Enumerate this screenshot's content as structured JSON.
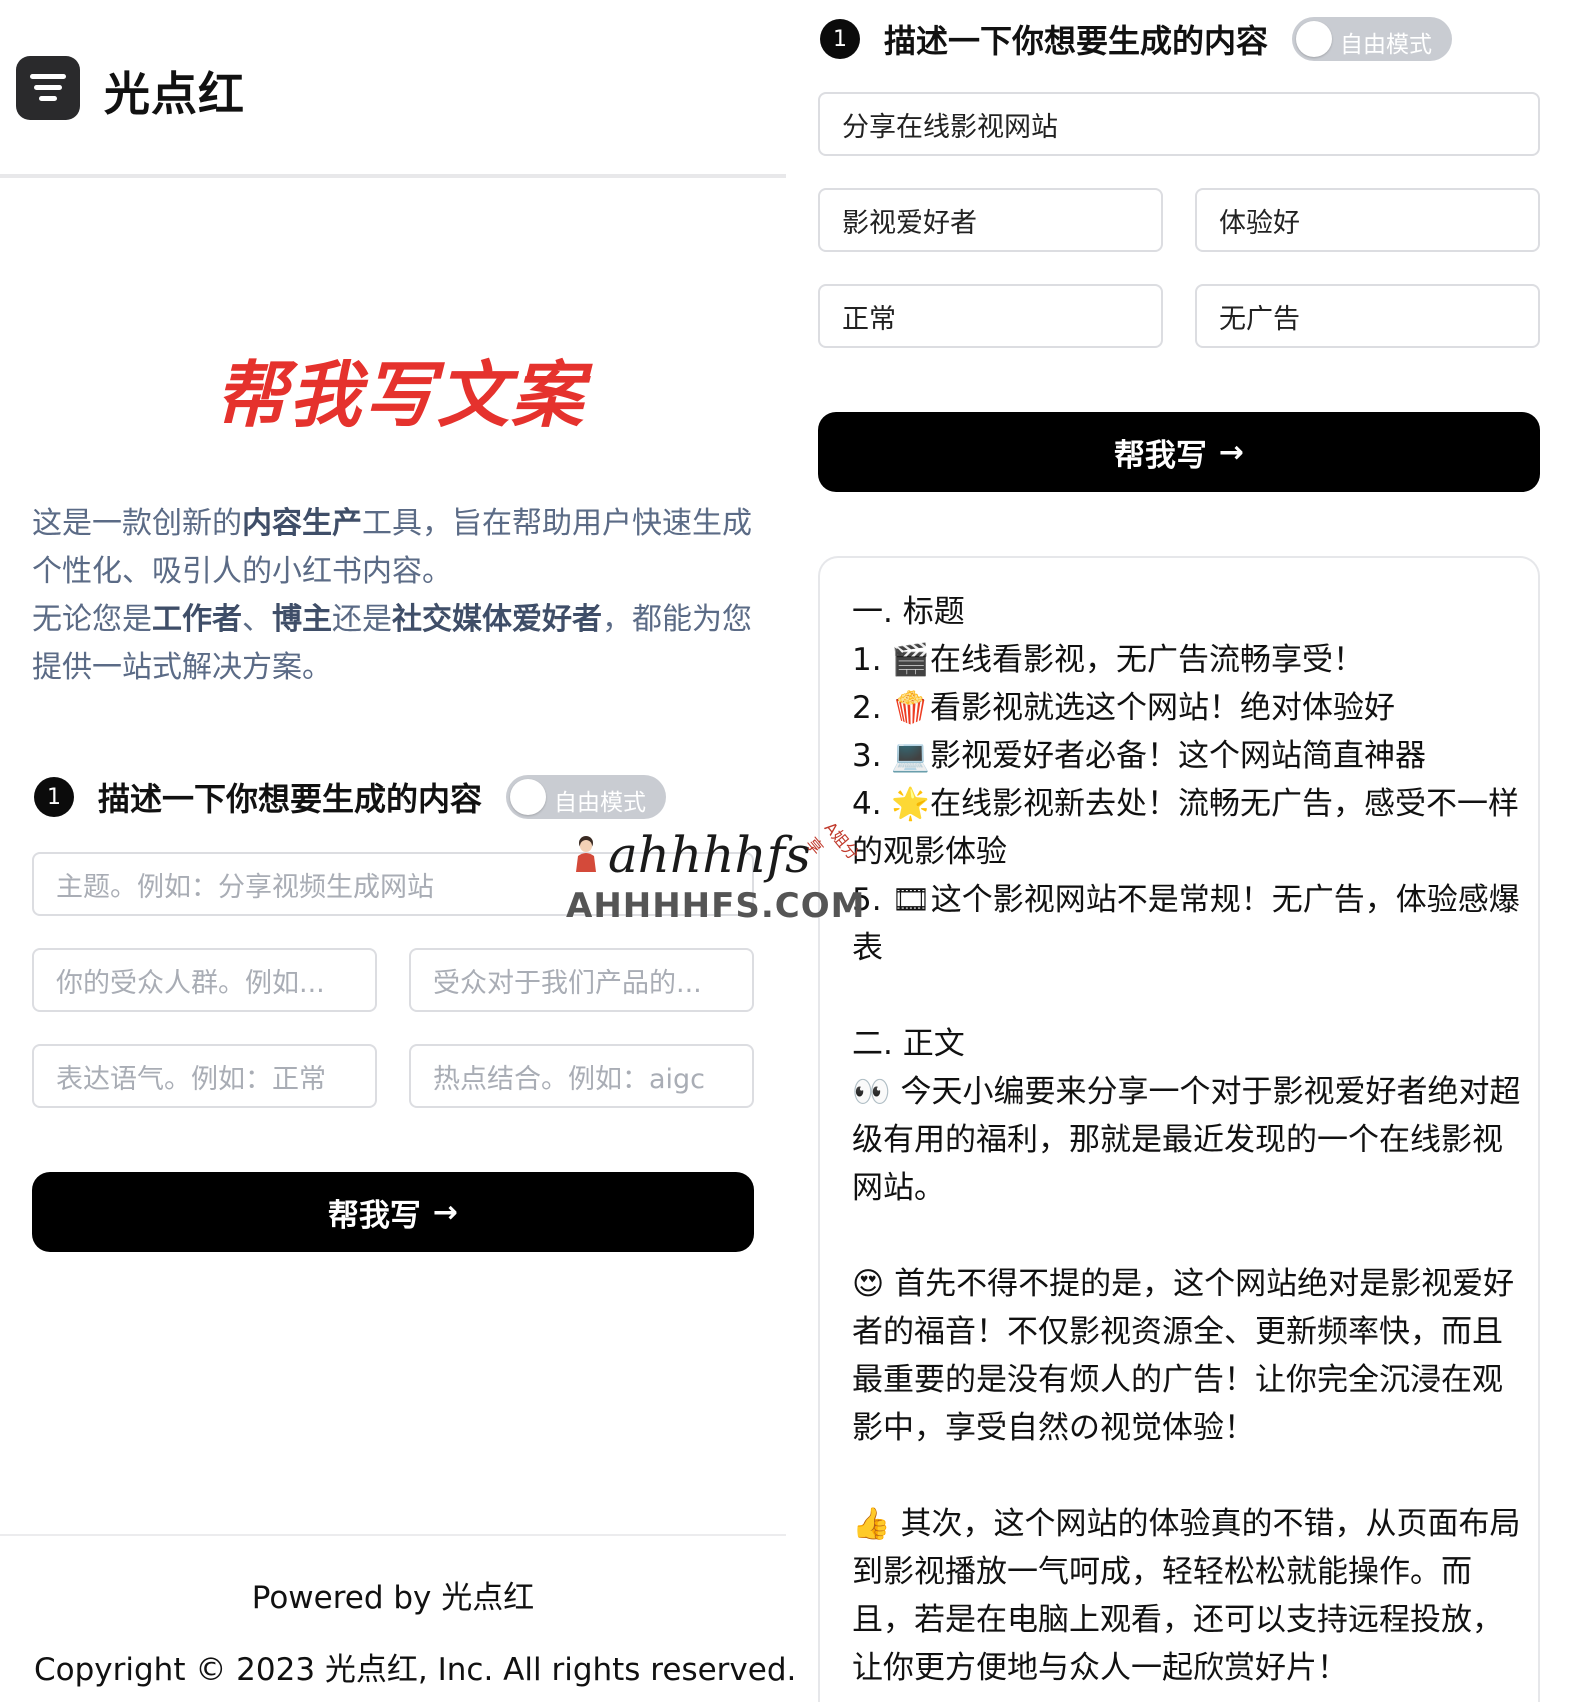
{
  "app": {
    "name": "光点红"
  },
  "hero": {
    "title": "帮我写文案"
  },
  "intro": {
    "line1_a": "这是一款创新的",
    "line1_b": "内容生产",
    "line1_c": "工具，旨在帮助用户快速生成个性化、吸引人的小红书内容。",
    "line2_a": "无论您是",
    "line2_b": "工作者",
    "line2_c": "、",
    "line2_d": "博主",
    "line2_e": "还是",
    "line2_f": "社交媒体爱好者",
    "line2_g": "，都能为您提供一站式解决方案。"
  },
  "form_empty": {
    "step_number": "1",
    "step_title": "描述一下你想要生成的内容",
    "mode_toggle": "自由模式",
    "topic_placeholder": "主题。例如：分享视频生成网站",
    "audience_placeholder": "你的受众人群。例如...",
    "value_placeholder": "受众对于我们产品的...",
    "tone_placeholder": "表达语气。例如：正常",
    "trend_placeholder": "热点结合。例如：aigc",
    "submit_label": "帮我写",
    "submit_arrow": "→"
  },
  "form_filled": {
    "step_number": "1",
    "step_title": "描述一下你想要生成的内容",
    "mode_toggle": "自由模式",
    "topic_value": "分享在线影视网站",
    "audience_value": "影视爱好者",
    "value_value": "体验好",
    "tone_value": "正常",
    "trend_value": "无广告",
    "submit_label": "帮我写",
    "submit_arrow": "→"
  },
  "result": {
    "heading_title": "一. 标题",
    "titles": [
      "1. 🎬在线看影视，无广告流畅享受！",
      "2. 🍿看影视就选这个网站！绝对体验好",
      "3. 💻影视爱好者必备！这个网站简直神器",
      "4. 🌟在线影视新去处！流畅无广告，感受不一样的观影体验",
      "5. 🎞这个影视网站不是常规！无广告，体验感爆表"
    ],
    "heading_body": "二. 正文",
    "para1": "👀 今天小编要来分享一个对于影视爱好者绝对超级有用的福利，那就是最近发现的一个在线影视网站。",
    "para2": "😍 首先不得不提的是，这个网站绝对是影视爱好者的福音！不仅影视资源全、更新频率快，而且最重要的是没有烦人的广告！让你完全沉浸在观影中，享受自然の视觉体验！",
    "para3": "👍 其次，这个网站的体验真的不错，从页面布局到影视播放一气呵成，轻轻松松就能操作。而且，若是在电脑上观看，还可以支持远程投放，让你更方便地与众人一起欣赏好片！"
  },
  "footer": {
    "powered": "Powered by 光点红",
    "copyright": "Copyright © 2023 光点红, Inc. All rights reserved."
  },
  "watermark": {
    "script": "ahhhhfs",
    "domain": "AHHHHFS.COM",
    "tag": "A姐分享"
  },
  "colors": {
    "accent_red": "#e5322d",
    "intro_text": "#5b6b86",
    "button_bg": "#000000",
    "toggle_off": "#c9ccd2"
  },
  "icons": {
    "logo": "filter-lines-icon",
    "arrow": "arrow-right-icon"
  }
}
